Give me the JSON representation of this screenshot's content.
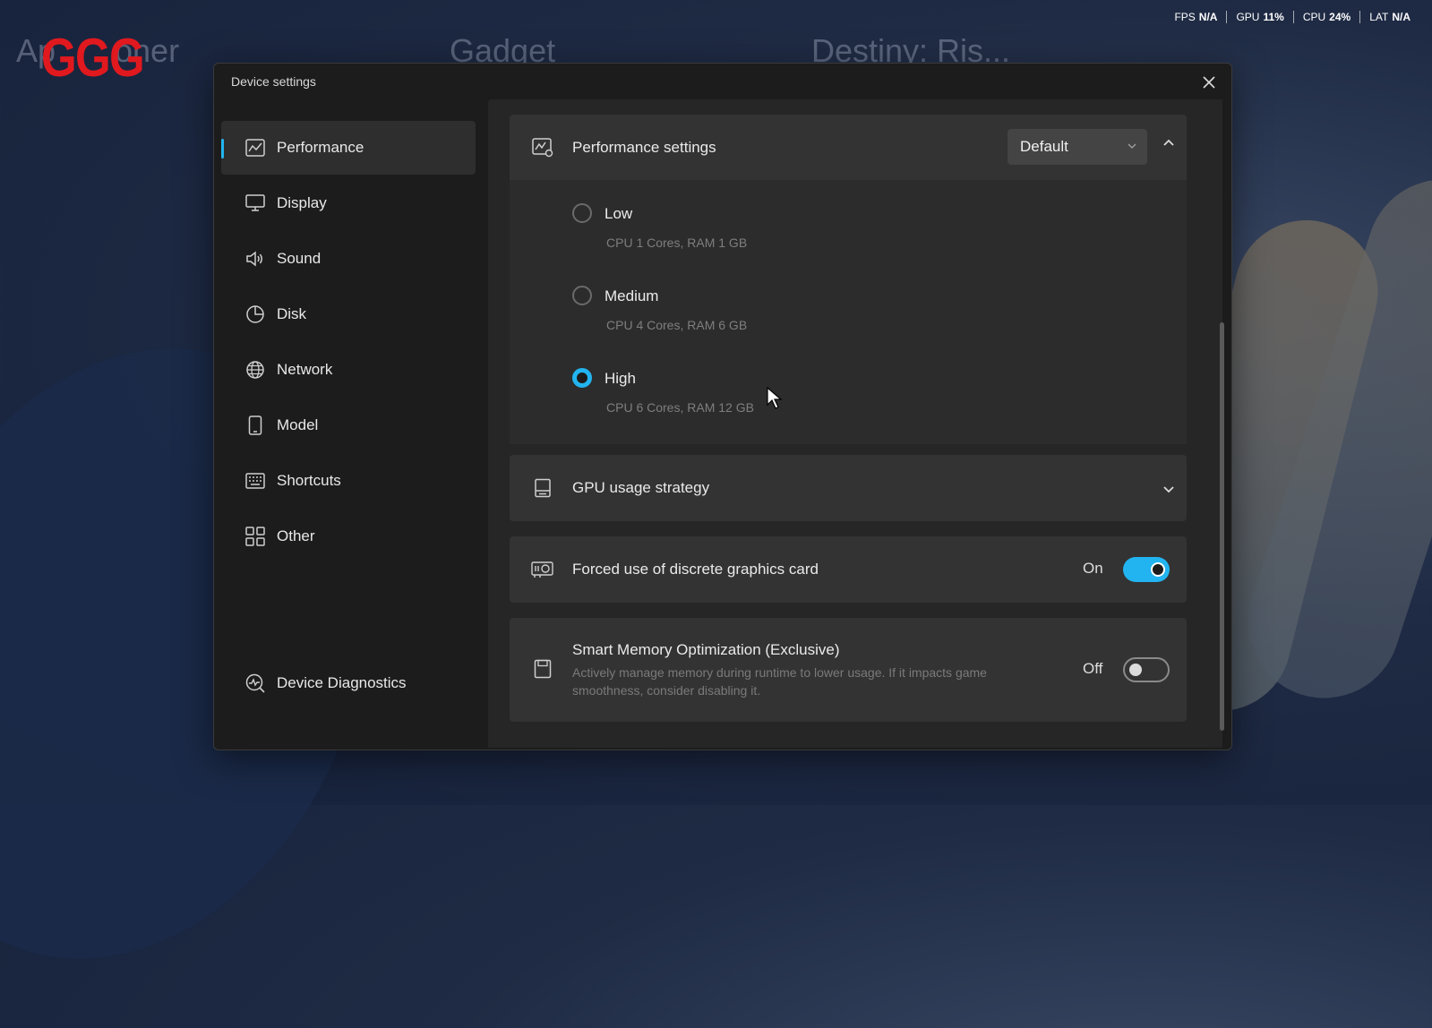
{
  "background": {
    "titles": [
      "Ap",
      "oner",
      "Gadget",
      "Destiny: Ris..."
    ],
    "logo": "GGG"
  },
  "stats": [
    {
      "label": "FPS",
      "value": "N/A"
    },
    {
      "label": "GPU",
      "value": "11%"
    },
    {
      "label": "CPU",
      "value": "24%"
    },
    {
      "label": "LAT",
      "value": "N/A"
    }
  ],
  "dialog": {
    "title": "Device settings",
    "close_icon": "close-icon"
  },
  "sidebar": {
    "items": [
      {
        "label": "Performance",
        "icon": "chart-icon",
        "active": true
      },
      {
        "label": "Display",
        "icon": "monitor-icon"
      },
      {
        "label": "Sound",
        "icon": "speaker-icon"
      },
      {
        "label": "Disk",
        "icon": "pie-icon"
      },
      {
        "label": "Network",
        "icon": "globe-icon"
      },
      {
        "label": "Model",
        "icon": "phone-icon"
      },
      {
        "label": "Shortcuts",
        "icon": "keyboard-icon"
      },
      {
        "label": "Other",
        "icon": "grid-icon"
      }
    ],
    "diagnostics": {
      "label": "Device Diagnostics",
      "icon": "diagnostics-icon"
    }
  },
  "performance": {
    "title": "Performance settings",
    "preset": "Default",
    "options": [
      {
        "label": "Low",
        "desc": "CPU 1 Cores, RAM 1 GB",
        "selected": false
      },
      {
        "label": "Medium",
        "desc": "CPU 4 Cores, RAM 6 GB",
        "selected": false
      },
      {
        "label": "High",
        "desc": "CPU 6 Cores, RAM 12 GB",
        "selected": true
      }
    ]
  },
  "gpu_strategy": {
    "title": "GPU usage strategy"
  },
  "discrete_gpu": {
    "title": "Forced use of discrete graphics card",
    "state": "On"
  },
  "smart_memory": {
    "title": "Smart Memory Optimization (Exclusive)",
    "desc_line1": "Actively manage memory during runtime to lower usage. If it impacts game",
    "desc_line2": "smoothness, consider disabling it.",
    "state": "Off"
  },
  "colors": {
    "accent": "#22b4f0",
    "logo": "#e0191f"
  }
}
